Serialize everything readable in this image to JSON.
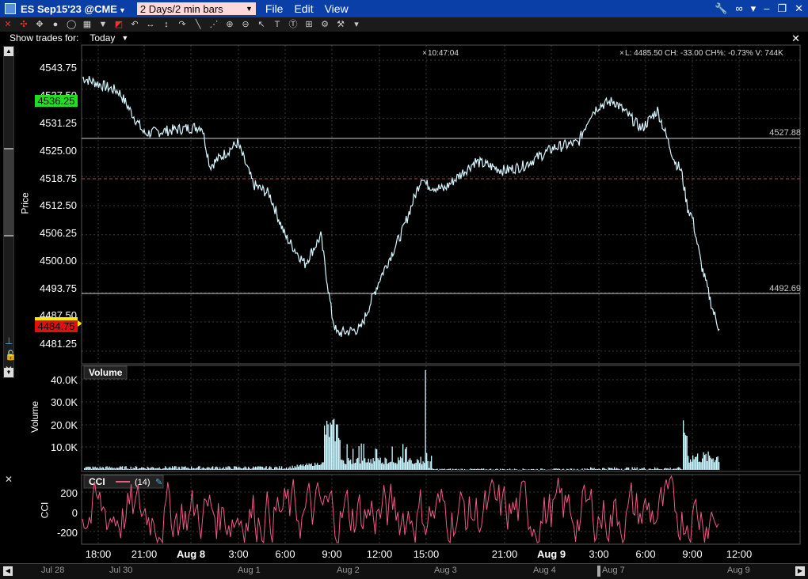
{
  "titlebar": {
    "symbol": "ES Sep15'23 @CME",
    "timeframe": "2 Days/2 min bars",
    "menus": [
      "File",
      "Edit",
      "View"
    ]
  },
  "trades": {
    "label": "Show trades for:",
    "value": "Today"
  },
  "price_pane": {
    "axis_title": "Price",
    "ticks": [
      "4543.75",
      "4537.50",
      "4531.25",
      "4525.00",
      "4518.75",
      "4512.50",
      "4506.25",
      "4500.00",
      "4493.75",
      "4487.50",
      "4481.25"
    ],
    "badge_high": "4536.25",
    "badge_last": "4484.75",
    "crosshair_time": "10:47:04",
    "info": "L: 4485.50 CH: -33.00 CH%: -0.73% V: 744K",
    "line_upper": "4527.88",
    "line_lower": "4492.69",
    "colors": {
      "price": "#d6f7ff",
      "dashed": "#a64a4a",
      "high_badge": "#22dd22",
      "last_badge": "#e01010"
    }
  },
  "volume_pane": {
    "title": "Volume",
    "axis_title": "Volume",
    "ticks": [
      "40.0K",
      "30.0K",
      "20.0K",
      "10.0K"
    ],
    "color": "#c8f6ff"
  },
  "cci_pane": {
    "title": "CCI",
    "period": "(14)",
    "axis_title": "CCI",
    "ticks": [
      "200",
      "0",
      "-200"
    ],
    "color": "#ee5a86"
  },
  "time_axis": {
    "ticks": [
      "18:00",
      "21:00",
      "Aug 8",
      "3:00",
      "6:00",
      "9:00",
      "12:00",
      "15:00",
      "21:00",
      "Aug 9",
      "3:00",
      "6:00",
      "9:00",
      "12:00"
    ]
  },
  "navigator": {
    "ticks": [
      "Jul 28",
      "Jul 30",
      "Aug 1",
      "Aug 2",
      "Aug 3",
      "Aug 4",
      "Aug 7",
      "Aug 9"
    ]
  },
  "chart_data": {
    "type": "line",
    "title": "ES Sep15'23 @CME",
    "xlabel": "",
    "ylabel": "Price",
    "ylim": [
      4478.5,
      4547
    ],
    "x": [
      "17:00",
      "19:30",
      "21:00",
      "23:00",
      "01:00",
      "02:00",
      "03:00",
      "04:00",
      "05:00",
      "06:00",
      "07:00",
      "08:00",
      "09:00",
      "09:30",
      "10:00",
      "10:30",
      "11:30",
      "12:30",
      "13:30",
      "14:30",
      "15:00",
      "16:00",
      "18:00",
      "20:00",
      "22:00",
      "00:00",
      "02:00",
      "03:00",
      "04:00",
      "05:30",
      "06:30",
      "07:30",
      "08:00",
      "08:30",
      "09:00",
      "09:30",
      "10:00",
      "10:47"
    ],
    "series": [
      {
        "values": [
          4540.0,
          4537.0,
          4528.0,
          4529.0,
          4529.5,
          4521.0,
          4526.0,
          4517.0,
          4515.0,
          4506.0,
          4500.0,
          4506.0,
          4489.0,
          4485.0,
          4485.5,
          4486.0,
          4497.0,
          4507.0,
          4519.0,
          4517.0,
          4516.0,
          4522.0,
          4520.0,
          4521.0,
          4525.0,
          4526.0,
          4532.0,
          4534.0,
          4535.0,
          4529.0,
          4533.0,
          4522.0,
          4520.0,
          4512.0,
          4510.0,
          4500.0,
          4490.0,
          4486.0
        ]
      }
    ],
    "volume_k": {
      "pre_open": 1.0,
      "open_peak": 23.0,
      "session_avg": 4.0,
      "close_spike": 44.0,
      "day2_open_peak": 22.0,
      "day2_session": 5.5
    },
    "cci_range": [
      -220,
      270
    ],
    "grid": true
  }
}
